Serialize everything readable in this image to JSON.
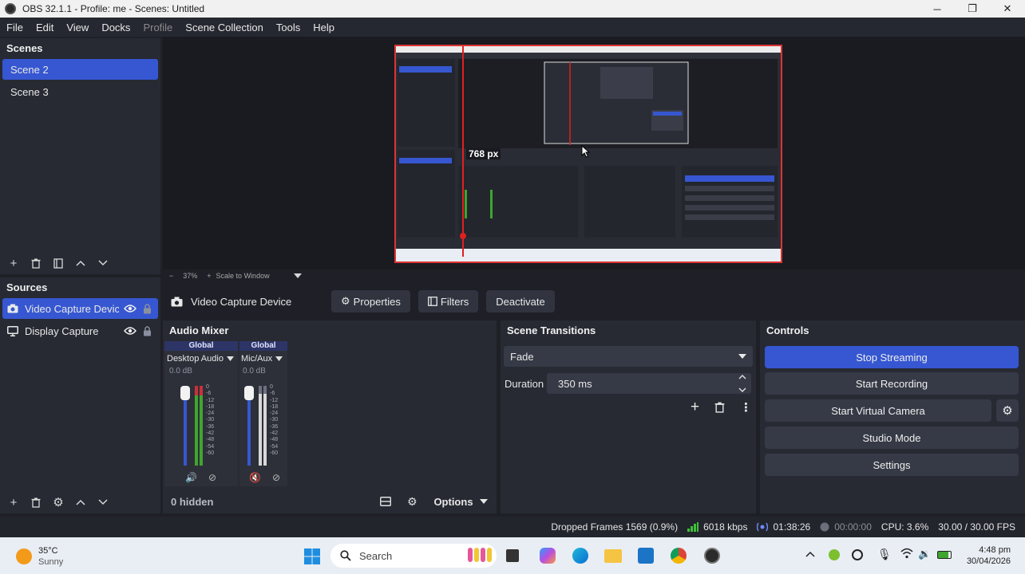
{
  "window": {
    "title": "OBS 32.1.1 - Profile: me - Scenes: Untitled"
  },
  "menu": [
    "File",
    "Edit",
    "View",
    "Docks",
    "Profile",
    "Scene Collection",
    "Tools",
    "Help"
  ],
  "scenes": {
    "title": "Scenes",
    "items": [
      "Scene 2",
      "Scene 3"
    ],
    "selected_index": 0
  },
  "sources": {
    "title": "Sources",
    "items": [
      "Video Capture Devic",
      "Display Capture"
    ]
  },
  "preview": {
    "measure_label": "768 px",
    "zoom": "37%",
    "scale_label": "Scale to Window"
  },
  "source_toolbar": {
    "name": "Video Capture Device",
    "properties": "Properties",
    "filters": "Filters",
    "deactivate": "Deactivate"
  },
  "audio_mixer": {
    "title": "Audio Mixer",
    "channels": [
      {
        "scope": "Global",
        "name": "Desktop Audio",
        "db": "0.0 dB"
      },
      {
        "scope": "Global",
        "name": "Mic/Aux",
        "db": "0.0 dB"
      }
    ],
    "scale": [
      "0",
      "-6",
      "-12",
      "-18",
      "-24",
      "-30",
      "-36",
      "-42",
      "-48",
      "-54",
      "-60"
    ],
    "hidden": "0 hidden",
    "options": "Options"
  },
  "transitions": {
    "title": "Scene Transitions",
    "selected": "Fade",
    "duration_label": "Duration",
    "duration_value": "350 ms"
  },
  "controls": {
    "title": "Controls",
    "buttons": [
      "Stop Streaming",
      "Start Recording",
      "Start Virtual Camera",
      "Studio Mode",
      "Settings"
    ]
  },
  "status": {
    "dropped": "Dropped Frames 1569 (0.9%)",
    "kbps": "6018 kbps",
    "stream_time": "01:38:26",
    "rec_time": "00:00:00",
    "cpu": "CPU: 3.6%",
    "fps": "30.00 / 30.00 FPS"
  },
  "taskbar": {
    "weather_temp": "35°C",
    "weather_desc": "Sunny",
    "search": "Search",
    "time": "4:48 pm",
    "date": "30/04/2026"
  },
  "colors": {
    "accent": "#3657d1",
    "panel": "#272a33",
    "background": "#1f2027",
    "meter_green": "#3fa52e",
    "meter_red": "#c9303a"
  }
}
